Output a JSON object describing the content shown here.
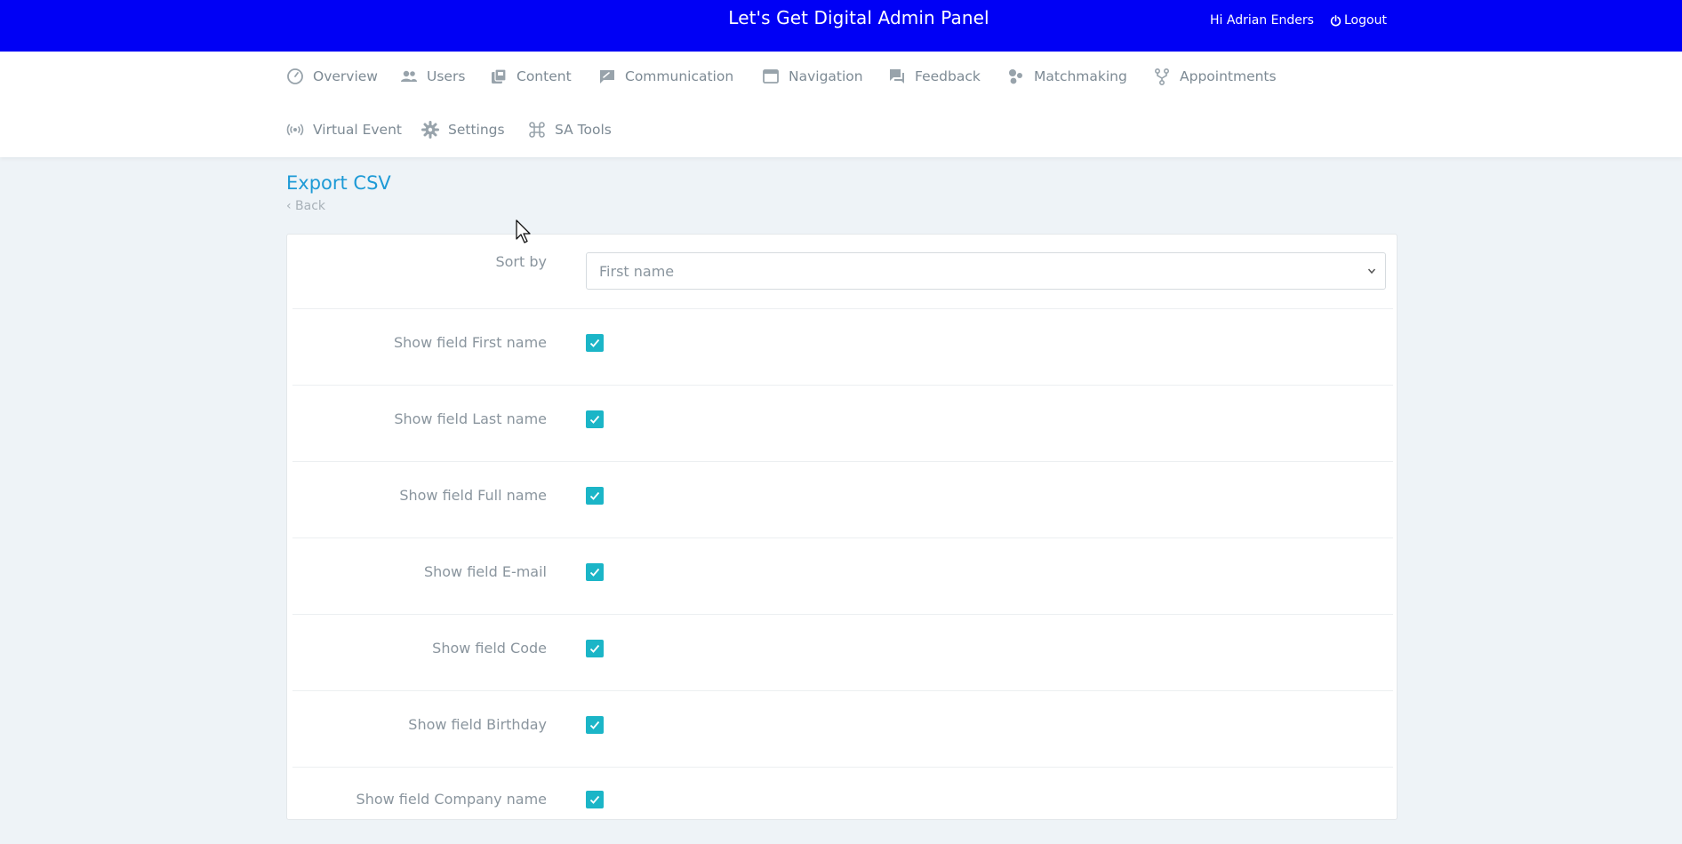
{
  "header": {
    "title": "Let's Get Digital Admin Panel",
    "greeting": "Hi Adrian Enders",
    "logout_label": "Logout",
    "bg_color": "#0000f5"
  },
  "nav": {
    "items": [
      {
        "label": "Overview",
        "icon": "dashboard-icon"
      },
      {
        "label": "Users",
        "icon": "users-icon"
      },
      {
        "label": "Content",
        "icon": "content-icon"
      },
      {
        "label": "Communication",
        "icon": "communication-icon"
      },
      {
        "label": "Navigation",
        "icon": "window-icon"
      },
      {
        "label": "Feedback",
        "icon": "chat-icon"
      },
      {
        "label": "Matchmaking",
        "icon": "bubbles-icon"
      },
      {
        "label": "Appointments",
        "icon": "fork-icon"
      },
      {
        "label": "Virtual Event",
        "icon": "broadcast-icon"
      },
      {
        "label": "Settings",
        "icon": "gear-icon"
      },
      {
        "label": "SA Tools",
        "icon": "command-icon"
      }
    ]
  },
  "page": {
    "title": "Export CSV",
    "back_label": "‹ Back",
    "title_color": "#1d9ad6"
  },
  "form": {
    "sort_label": "Sort by",
    "sort_value": "First name",
    "fields": [
      {
        "label": "Show field First name",
        "checked": true
      },
      {
        "label": "Show field Last name",
        "checked": true
      },
      {
        "label": "Show field Full name",
        "checked": true
      },
      {
        "label": "Show field E-mail",
        "checked": true
      },
      {
        "label": "Show field Code",
        "checked": true
      },
      {
        "label": "Show field Birthday",
        "checked": true
      },
      {
        "label": "Show field Company name",
        "checked": true
      }
    ],
    "checkbox_color": "#1bb5c7"
  }
}
